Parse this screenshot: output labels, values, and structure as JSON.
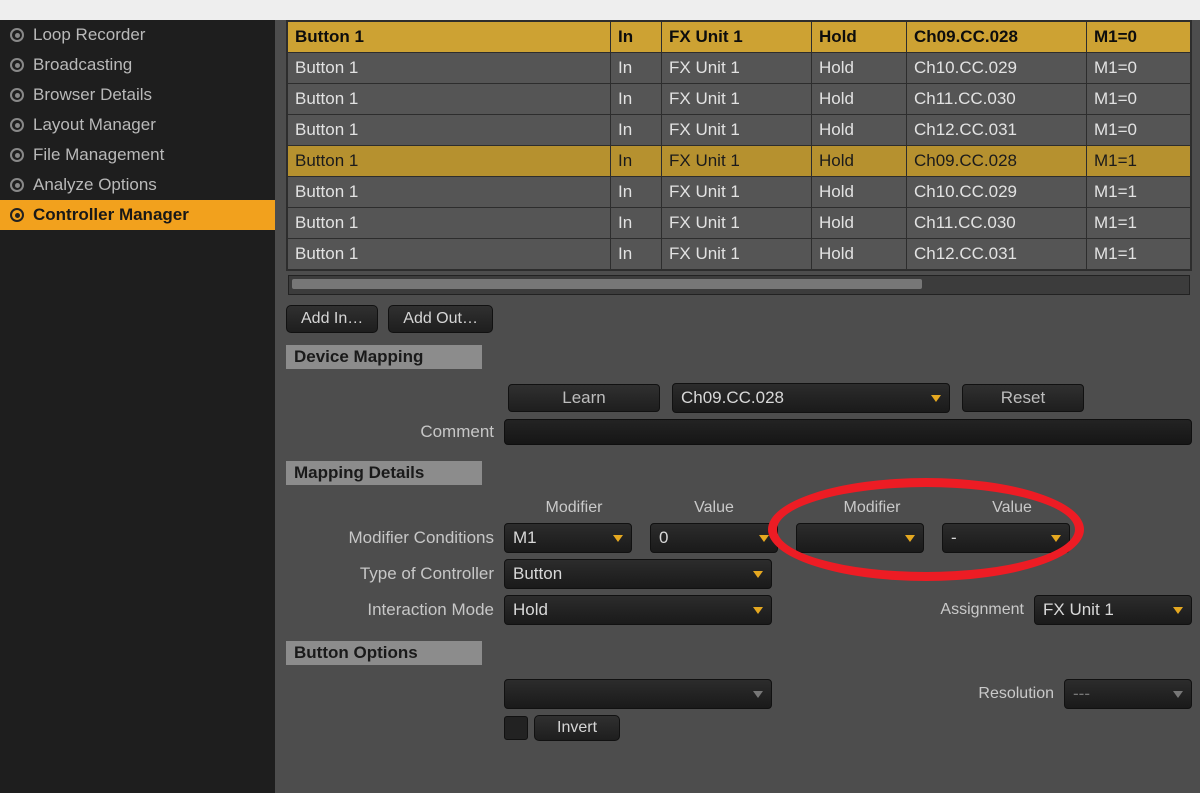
{
  "sidebar": {
    "items": [
      {
        "label": "Loop Recorder"
      },
      {
        "label": "Broadcasting"
      },
      {
        "label": "Browser Details"
      },
      {
        "label": "Layout Manager"
      },
      {
        "label": "File Management"
      },
      {
        "label": "Analyze Options"
      },
      {
        "label": "Controller Manager"
      }
    ],
    "selected_index": 6
  },
  "table": {
    "rows": [
      {
        "control": "Button 1",
        "io": "In",
        "assign": "FX Unit 1",
        "mode": "Hold",
        "mapped": "Ch09.CC.028",
        "cond": "M1=0",
        "sel": "primary"
      },
      {
        "control": "Button 1",
        "io": "In",
        "assign": "FX Unit 1",
        "mode": "Hold",
        "mapped": "Ch10.CC.029",
        "cond": "M1=0",
        "sel": ""
      },
      {
        "control": "Button 1",
        "io": "In",
        "assign": "FX Unit 1",
        "mode": "Hold",
        "mapped": "Ch11.CC.030",
        "cond": "M1=0",
        "sel": ""
      },
      {
        "control": "Button 1",
        "io": "In",
        "assign": "FX Unit 1",
        "mode": "Hold",
        "mapped": "Ch12.CC.031",
        "cond": "M1=0",
        "sel": ""
      },
      {
        "control": "Button 1",
        "io": "In",
        "assign": "FX Unit 1",
        "mode": "Hold",
        "mapped": "Ch09.CC.028",
        "cond": "M1=1",
        "sel": "sel"
      },
      {
        "control": "Button 1",
        "io": "In",
        "assign": "FX Unit 1",
        "mode": "Hold",
        "mapped": "Ch10.CC.029",
        "cond": "M1=1",
        "sel": ""
      },
      {
        "control": "Button 1",
        "io": "In",
        "assign": "FX Unit 1",
        "mode": "Hold",
        "mapped": "Ch11.CC.030",
        "cond": "M1=1",
        "sel": ""
      },
      {
        "control": "Button 1",
        "io": "In",
        "assign": "FX Unit 1",
        "mode": "Hold",
        "mapped": "Ch12.CC.031",
        "cond": "M1=1",
        "sel": ""
      }
    ]
  },
  "buttons": {
    "add_in": "Add In…",
    "add_out": "Add Out…"
  },
  "device_mapping": {
    "title": "Device Mapping",
    "learn": "Learn",
    "mapped_value": "Ch09.CC.028",
    "reset": "Reset",
    "comment_label": "Comment"
  },
  "mapping_details": {
    "title": "Mapping Details",
    "col_modifier": "Modifier",
    "col_value": "Value",
    "row_modifier_conditions": "Modifier Conditions",
    "mod1": "M1",
    "val1": "0",
    "mod2": "",
    "val2": "-",
    "row_type_of_controller": "Type of Controller",
    "type_value": "Button",
    "row_interaction_mode": "Interaction Mode",
    "interaction_value": "Hold",
    "assignment_label": "Assignment",
    "assignment_value": "FX Unit 1"
  },
  "button_options": {
    "title": "Button Options",
    "invert": "Invert",
    "resolution_label": "Resolution",
    "resolution_value": "---"
  }
}
